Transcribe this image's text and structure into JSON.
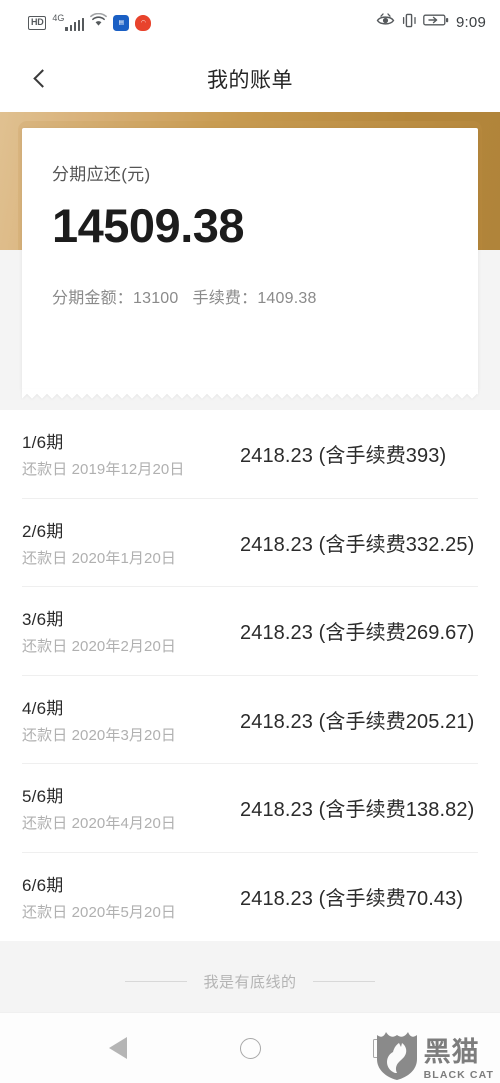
{
  "status_bar": {
    "hd_badge": "HD",
    "network_label": "4G",
    "signal_bars": 5,
    "app_icons": [
      "blue-app-icon",
      "red-app-icon"
    ],
    "eye_icon": "eye-care-icon",
    "vibrate_icon": "vibrate-icon",
    "battery_icon": "battery-charging-icon",
    "clock": "9:09"
  },
  "header": {
    "back_icon": "chevron-left-icon",
    "title": "我的账单"
  },
  "bill_card": {
    "label": "分期应还(元)",
    "amount": "14509.38",
    "principal_label": "分期金额：",
    "principal_value": "13100",
    "fee_label": "手续费：",
    "fee_value": "1409.38",
    "accent_color": "#c09a57"
  },
  "installments": [
    {
      "term": "1/6期",
      "date_label": "还款日",
      "date": "2019年12月20日",
      "amount": "2418.23 (含手续费393)"
    },
    {
      "term": "2/6期",
      "date_label": "还款日",
      "date": "2020年1月20日",
      "amount": "2418.23 (含手续费332.25)"
    },
    {
      "term": "3/6期",
      "date_label": "还款日",
      "date": "2020年2月20日",
      "amount": "2418.23 (含手续费269.67)"
    },
    {
      "term": "4/6期",
      "date_label": "还款日",
      "date": "2020年3月20日",
      "amount": "2418.23 (含手续费205.21)"
    },
    {
      "term": "5/6期",
      "date_label": "还款日",
      "date": "2020年4月20日",
      "amount": "2418.23 (含手续费138.82)"
    },
    {
      "term": "6/6期",
      "date_label": "还款日",
      "date": "2020年5月20日",
      "amount": "2418.23 (含手续费70.43)"
    }
  ],
  "list_end": {
    "text": "我是有底线的"
  },
  "system_nav": {
    "back": "back-triangle-icon",
    "home": "home-circle-icon",
    "recents": "recents-square-icon"
  },
  "watermark": {
    "shield": "black-cat-shield-logo",
    "cn_text": "黑猫",
    "en_text": "BLACK CAT"
  }
}
